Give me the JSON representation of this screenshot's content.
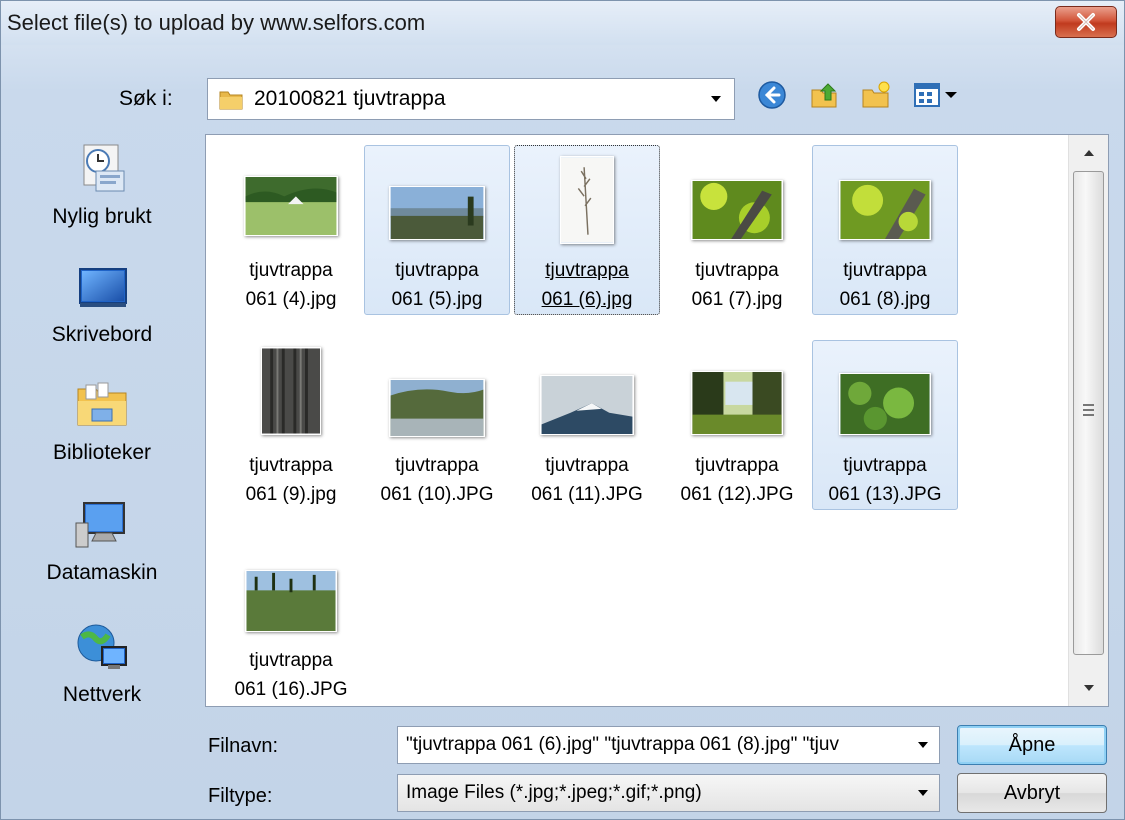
{
  "window": {
    "title": "Select file(s) to upload by www.selfors.com"
  },
  "lookin": {
    "label": "Søk i:",
    "path": "20100821 tjuvtrappa"
  },
  "places": [
    {
      "label": "Nylig brukt",
      "icon": "recent-places-icon"
    },
    {
      "label": "Skrivebord",
      "icon": "desktop-icon"
    },
    {
      "label": "Biblioteker",
      "icon": "libraries-icon"
    },
    {
      "label": "Datamaskin",
      "icon": "computer-icon"
    },
    {
      "label": "Nettverk",
      "icon": "network-icon"
    }
  ],
  "files": [
    {
      "name": "tjuvtrappa\n061 (4).jpg",
      "selected": false
    },
    {
      "name": "tjuvtrappa\n061 (5).jpg",
      "selected": true
    },
    {
      "name": "tjuvtrappa\n061 (6).jpg",
      "selected": true,
      "focused": true
    },
    {
      "name": "tjuvtrappa\n061 (7).jpg",
      "selected": false
    },
    {
      "name": "tjuvtrappa\n061 (8).jpg",
      "selected": true
    },
    {
      "name": "tjuvtrappa\n061 (9).jpg",
      "selected": false
    },
    {
      "name": "tjuvtrappa\n061 (10).JPG",
      "selected": false
    },
    {
      "name": "tjuvtrappa\n061 (11).JPG",
      "selected": false
    },
    {
      "name": "tjuvtrappa\n061 (12).JPG",
      "selected": false
    },
    {
      "name": "tjuvtrappa\n061 (13).JPG",
      "selected": true
    },
    {
      "name": "tjuvtrappa\n061 (16).JPG",
      "selected": false
    }
  ],
  "filename": {
    "label": "Filnavn:",
    "value": "\"tjuvtrappa 061 (6).jpg\" \"tjuvtrappa 061 (8).jpg\" \"tjuv"
  },
  "filetype": {
    "label": "Filtype:",
    "value": "Image Files (*.jpg;*.jpeg;*.gif;*.png)"
  },
  "buttons": {
    "open": "Åpne",
    "cancel": "Avbryt"
  }
}
